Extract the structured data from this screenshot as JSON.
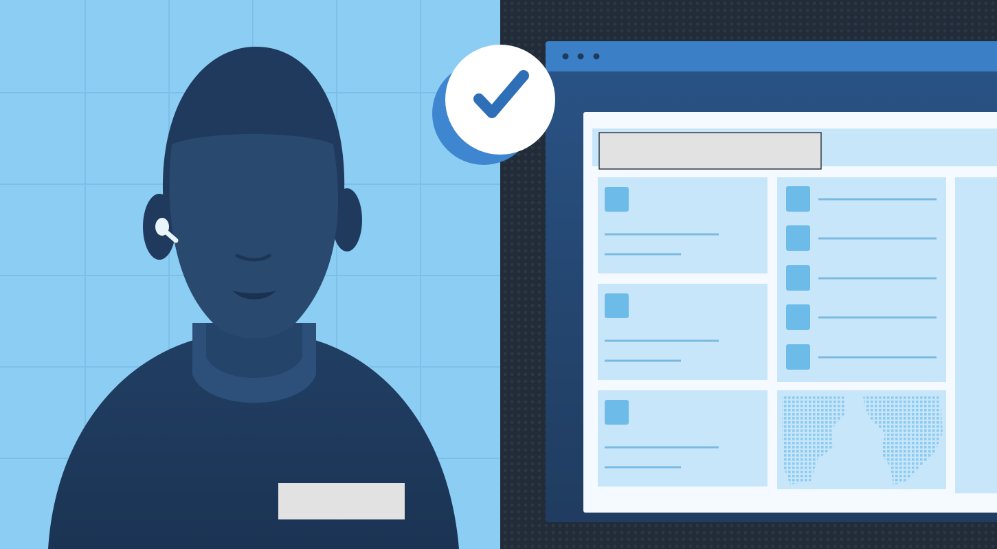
{
  "illustration": {
    "subject": "",
    "name_badge": {
      "text": ""
    },
    "verification_badge": {
      "icon": "checkmark-icon"
    },
    "browser_window": {
      "dots": [
        "dot-1",
        "dot-2",
        "dot-3"
      ],
      "header_field": {
        "text": ""
      },
      "left_cards": 3,
      "list_rows": 5
    },
    "colors": {
      "sky": "#8ccdf3",
      "grid_line": "#7ec2ec",
      "navy": "#1f3a5c",
      "face": "#29496e",
      "dark_bg": "#222c39",
      "window_bar": "#3b7fc6",
      "panel": "#c8e6fa",
      "check": "#2f6fb7"
    }
  }
}
